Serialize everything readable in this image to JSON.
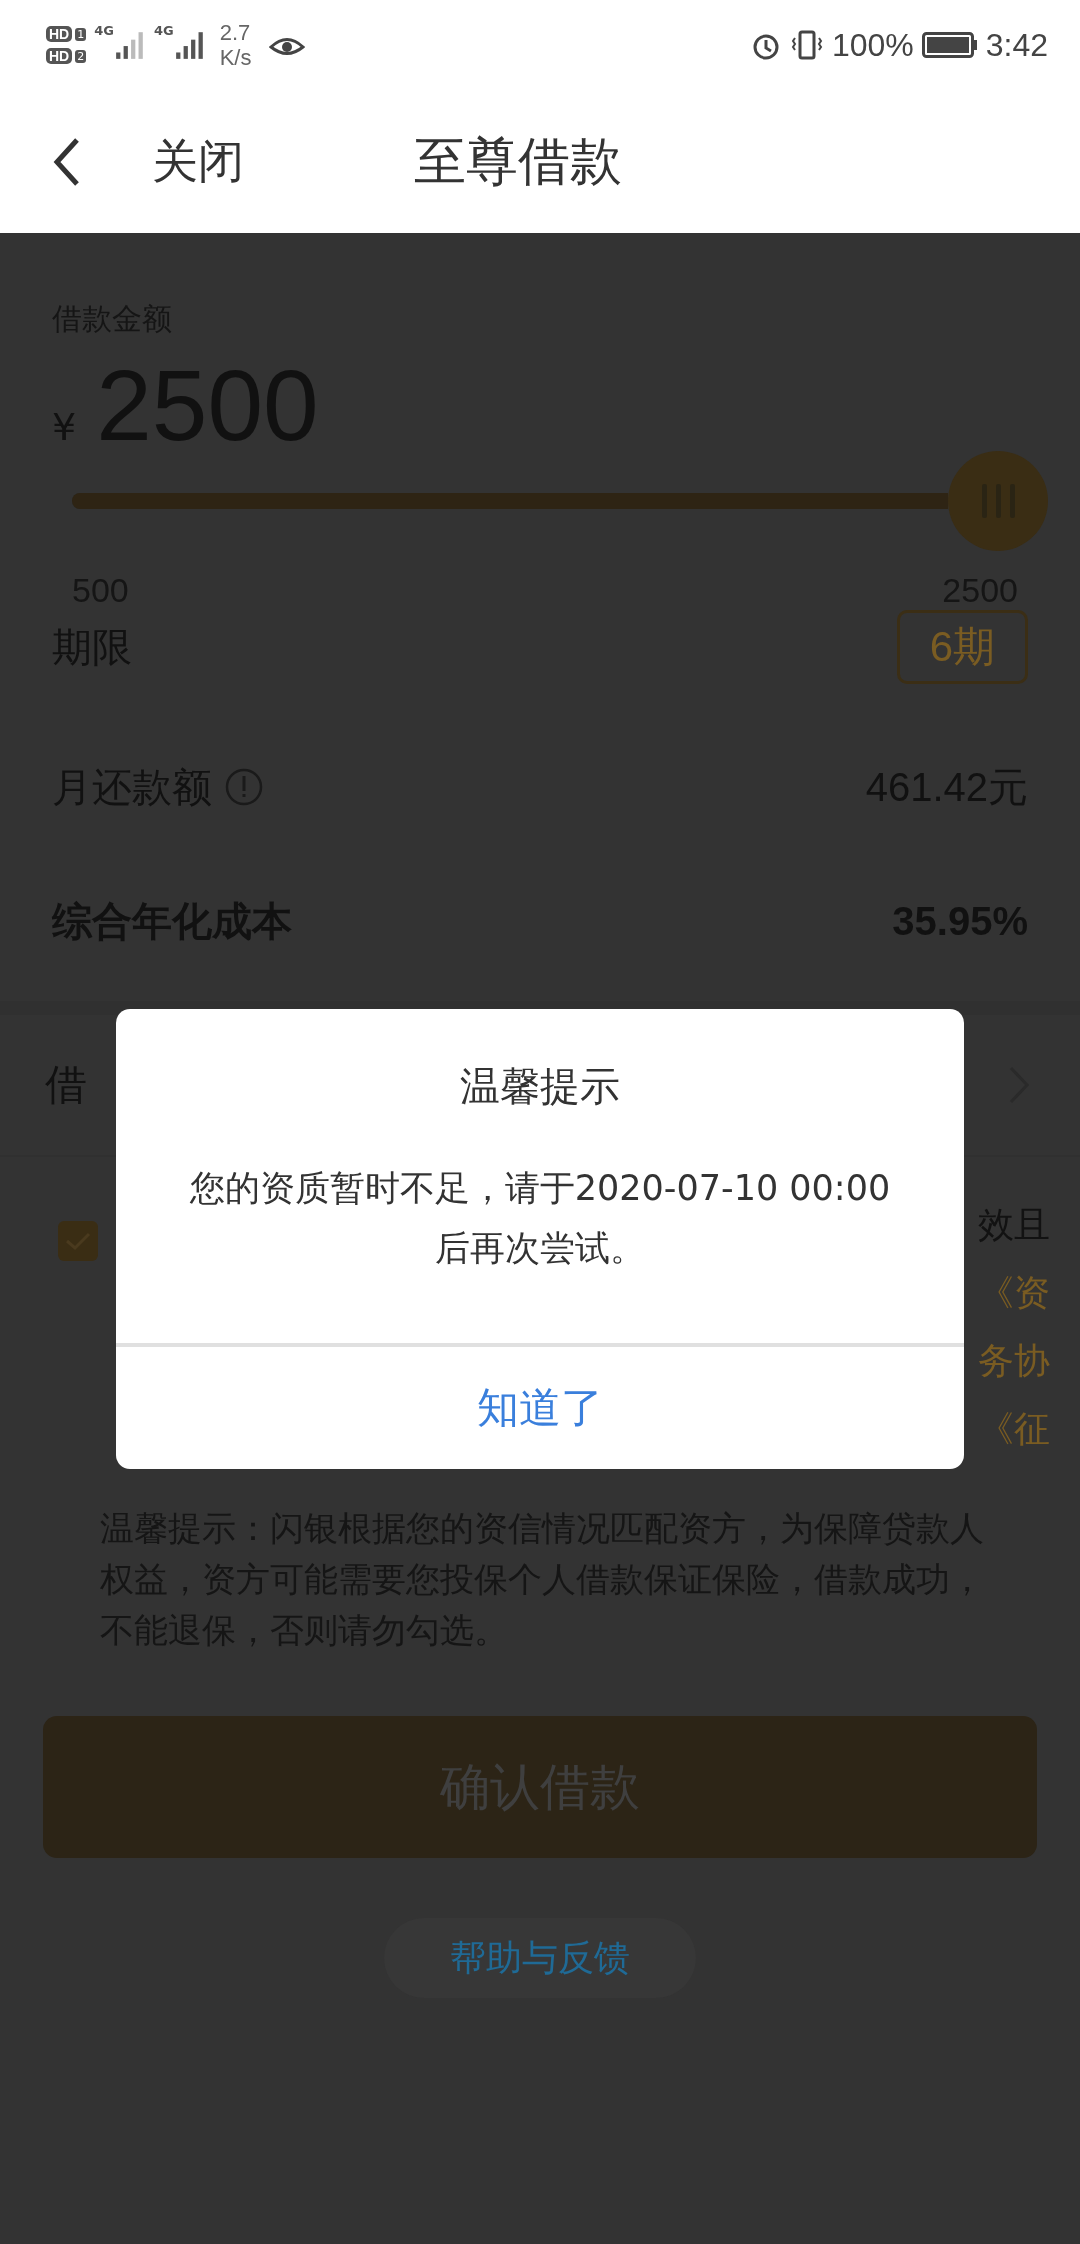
{
  "status_bar": {
    "sims": [
      {
        "label": "HD",
        "slot": "1"
      },
      {
        "label": "HD",
        "slot": "2"
      }
    ],
    "networks": [
      "4G",
      "4G"
    ],
    "speed_value": "2.7",
    "speed_unit": "K/s",
    "battery": "100%",
    "time": "3:42"
  },
  "header": {
    "back_label": "关闭",
    "title": "至尊借款"
  },
  "amount": {
    "label": "借款金额",
    "currency": "¥",
    "value": "2500",
    "slider": {
      "level": 1,
      "min_label": "500",
      "max_label": "2500"
    }
  },
  "term": {
    "label": "期限",
    "value": "6期"
  },
  "rows": [
    {
      "kind": "info",
      "label": "月还款额",
      "value": "461.42元"
    },
    {
      "kind": "bold",
      "label": "综合年化成本",
      "value": "35.95%"
    }
  ],
  "purpose_row": {
    "label": "借"
  },
  "agreement": {
    "checked": true,
    "visible_line_ends": [
      "效且",
      "《资",
      "务协",
      "《征"
    ]
  },
  "tips": "温馨提示：闪银根据您的资信情况匹配资方，为保障贷款人权益，资方可能需要您投保个人借款保证保险，借款成功，不能退保，否则请勿勾选。",
  "confirm_button": "确认借款",
  "help_button": "帮助与反馈",
  "dialog": {
    "title": "温馨提示",
    "message": "您的资质暂时不足，请于2020-07-10 00:00后再次尝试。",
    "button": "知道了"
  }
}
